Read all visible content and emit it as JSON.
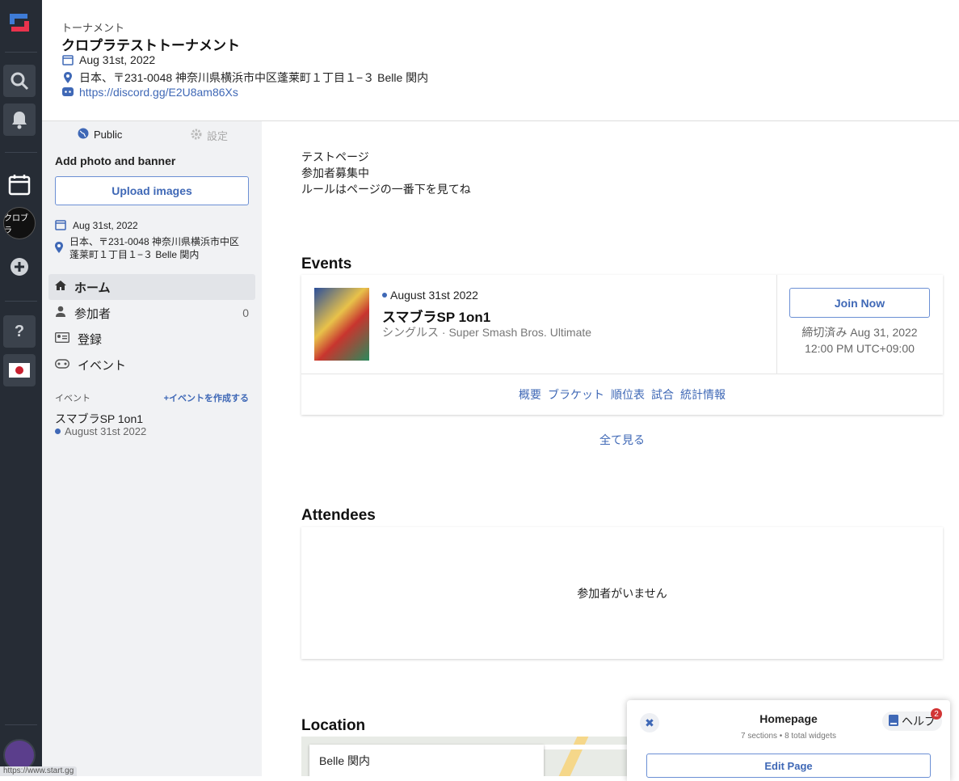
{
  "rail": {
    "icons": [
      "startgg-logo-icon",
      "search-icon",
      "bell-icon",
      "calendar-icon",
      "tournament-avatar",
      "add-icon",
      "help-icon",
      "japan-flag-icon",
      "user-avatar"
    ],
    "tournament_avatar_text": "クロブラ"
  },
  "header": {
    "type_label": "トーナメント",
    "title": "クロプラテストトーナメント",
    "date": "Aug 31st, 2022",
    "address": "日本、〒231-0048 神奈川県横浜市中区蓬莱町１丁目１−３ Belle 関内",
    "discord": "https://discord.gg/E2U8am86Xs"
  },
  "sidebar": {
    "visibility": "Public",
    "settings": "設定",
    "add_photo": "Add photo and banner",
    "upload": "Upload images",
    "date": "Aug 31st, 2022",
    "address_line1": "日本、〒231-0048 神奈川県横浜市中区",
    "address_line2": "蓬莱町１丁目１−３ Belle 関内",
    "nav": [
      {
        "label": "ホーム",
        "icon": "home-icon",
        "active": true
      },
      {
        "label": "参加者",
        "icon": "person-icon",
        "count": "0"
      },
      {
        "label": "登録",
        "icon": "id-card-icon"
      },
      {
        "label": "イベント",
        "icon": "gamepad-icon"
      }
    ],
    "events_header": "イベント",
    "create_event": "+イベントを作成する",
    "event_name": "スマブラSP 1on1",
    "event_date": "August 31st 2022"
  },
  "main": {
    "description": [
      "テストページ",
      "参加者募集中",
      "ルールはページの一番下を見てね"
    ],
    "events_title": "Events",
    "event": {
      "date": "August 31st 2022",
      "name": "スマブラSP 1on1",
      "game": "シングルス · Super Smash Bros. Ultimate",
      "join": "Join Now",
      "deadline_line1": "締切済み Aug 31, 2022",
      "deadline_line2": "12:00 PM UTC+09:00",
      "links": [
        "概要",
        "ブラケット",
        "順位表",
        "試合",
        "統計情報"
      ]
    },
    "see_all": "全て見る",
    "attendees_title": "Attendees",
    "no_attendees": "参加者がいません",
    "location_title": "Location",
    "map_label": "Belle 関内"
  },
  "panel": {
    "title": "Homepage",
    "subtitle": "7 sections • 8 total widgets",
    "help": "ヘルプ",
    "help_badge": "2",
    "edit": "Edit Page"
  },
  "statusbar": "https://www.start.gg",
  "colors": {
    "accent": "#3f68b6",
    "rail": "#262c35",
    "sidebar": "#f1f2f4",
    "badge": "#d23535"
  }
}
